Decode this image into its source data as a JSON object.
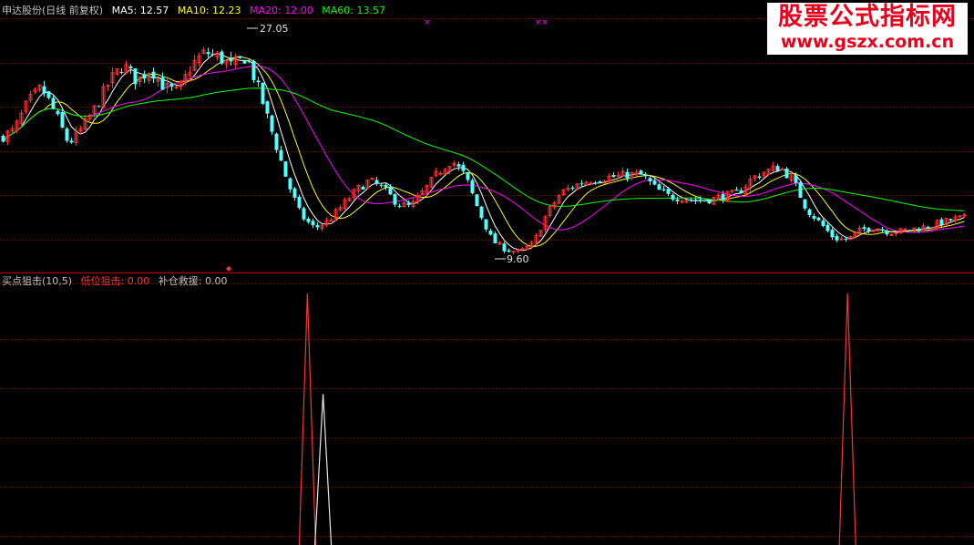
{
  "main_panel": {
    "stock_name": "申达股份",
    "period": "(日线 前复权)",
    "ma_labels": [
      {
        "label": "MA5: 12.57",
        "color": "#ffffff"
      },
      {
        "label": "MA10: 12.23",
        "color": "#ffff00"
      },
      {
        "label": "MA20: 12.00",
        "color": "#ff00ff"
      },
      {
        "label": "MA60: 13.57",
        "color": "#00ff00"
      }
    ],
    "high_label": "27.05",
    "low_label": "9.60"
  },
  "sub_panel": {
    "indicator_name": "买点狙击(10,5)",
    "outputs": [
      {
        "label": "低位狙击: 0.00",
        "color": "#ff3030"
      },
      {
        "label": "补仓救援: 0.00",
        "color": "#c0c0c0"
      }
    ]
  },
  "watermark": {
    "title": "股票公式指标网",
    "url": "www.gszx.com.cn"
  },
  "colors": {
    "up": "#ff3232",
    "down": "#54ffff",
    "ma5": "#ffffff",
    "ma10": "#ffff00",
    "ma20": "#ff00ff",
    "ma60": "#00ff00",
    "grid": "#8b0000",
    "divider": "#c00000"
  },
  "chart_data": [
    {
      "type": "candlestick",
      "title": "申达股份(日线 前复权)",
      "ylim": [
        8.8,
        28.5
      ],
      "price_annotations": [
        {
          "label": "27.05",
          "value": 27.05,
          "kind": "high"
        },
        {
          "label": "9.60",
          "value": 9.6,
          "kind": "low"
        }
      ],
      "moving_averages": [
        {
          "name": "MA5",
          "latest": 12.57
        },
        {
          "name": "MA10",
          "latest": 12.23
        },
        {
          "name": "MA20",
          "latest": 12.0
        },
        {
          "name": "MA60",
          "latest": 13.57
        }
      ],
      "close_path": [
        [
          0,
          19.0
        ],
        [
          15,
          19.6
        ],
        [
          30,
          21.8
        ],
        [
          45,
          23.0
        ],
        [
          60,
          21.0
        ],
        [
          75,
          18.5
        ],
        [
          90,
          19.8
        ],
        [
          105,
          21.5
        ],
        [
          120,
          23.5
        ],
        [
          135,
          24.8
        ],
        [
          150,
          23.5
        ],
        [
          165,
          24.5
        ],
        [
          180,
          23.0
        ],
        [
          195,
          22.6
        ],
        [
          210,
          24.8
        ],
        [
          225,
          25.8
        ],
        [
          240,
          25.4
        ],
        [
          255,
          24.6
        ],
        [
          270,
          25.5
        ],
        [
          285,
          22.5
        ],
        [
          300,
          19.0
        ],
        [
          315,
          15.5
        ],
        [
          330,
          12.8
        ],
        [
          345,
          11.8
        ],
        [
          360,
          12.4
        ],
        [
          375,
          13.6
        ],
        [
          390,
          14.8
        ],
        [
          405,
          15.6
        ],
        [
          420,
          15.0
        ],
        [
          435,
          13.8
        ],
        [
          450,
          13.5
        ],
        [
          465,
          14.8
        ],
        [
          480,
          16.2
        ],
        [
          495,
          17.2
        ],
        [
          510,
          16.0
        ],
        [
          525,
          13.2
        ],
        [
          540,
          10.8
        ],
        [
          555,
          10.1
        ],
        [
          570,
          9.9
        ],
        [
          585,
          10.6
        ],
        [
          600,
          13.0
        ],
        [
          615,
          14.6
        ],
        [
          630,
          15.2
        ],
        [
          645,
          15.6
        ],
        [
          660,
          15.8
        ],
        [
          675,
          15.9
        ],
        [
          690,
          16.1
        ],
        [
          705,
          16.0
        ],
        [
          720,
          14.9
        ],
        [
          735,
          14.3
        ],
        [
          750,
          14.2
        ],
        [
          765,
          14.0
        ],
        [
          780,
          14.1
        ],
        [
          795,
          14.4
        ],
        [
          810,
          14.6
        ],
        [
          825,
          15.8
        ],
        [
          840,
          16.3
        ],
        [
          855,
          16.7
        ],
        [
          870,
          15.6
        ],
        [
          885,
          13.3
        ],
        [
          900,
          12.2
        ],
        [
          915,
          11.0
        ],
        [
          930,
          10.9
        ],
        [
          945,
          11.7
        ],
        [
          960,
          11.9
        ],
        [
          975,
          11.5
        ],
        [
          990,
          11.6
        ],
        [
          1005,
          11.8
        ],
        [
          1020,
          12.0
        ],
        [
          1035,
          12.3
        ],
        [
          1050,
          12.6
        ]
      ]
    },
    {
      "type": "line",
      "title": "买点狙击(10,5)",
      "ylim": [
        0,
        1
      ],
      "series": [
        {
          "name": "低位狙击",
          "spikes_at_bar": [
            22,
            61
          ],
          "peak": 1.0
        },
        {
          "name": "补仓救援",
          "spikes_at_bar": [
            23
          ],
          "peak": 0.6
        }
      ]
    }
  ]
}
